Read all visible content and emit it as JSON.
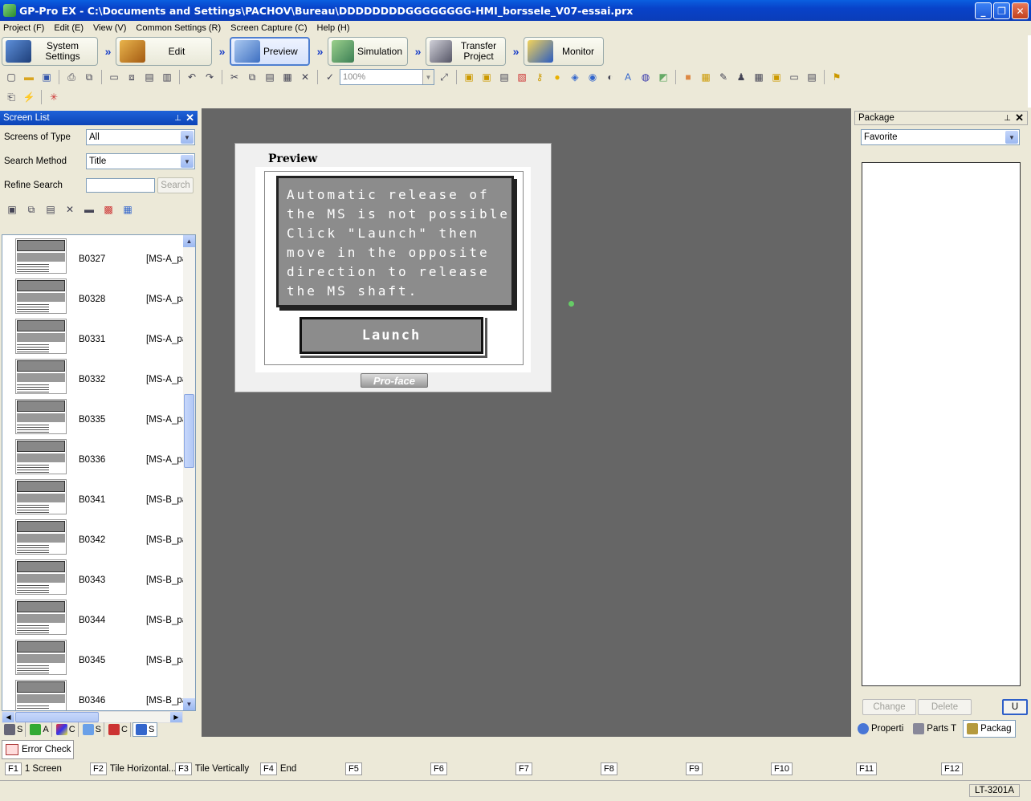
{
  "window": {
    "title": "GP-Pro EX - C:\\Documents and Settings\\PACHOV\\Bureau\\DDDDDDDDGGGGGGGG-HMI_borssele_V07-essai.prx",
    "minimize": "_",
    "maximize": "❐",
    "close": "✕"
  },
  "menu": [
    "Project (F)",
    "Edit (E)",
    "View (V)",
    "Common Settings (R)",
    "Screen Capture (C)",
    "Help (H)"
  ],
  "workflow": [
    {
      "label": "System Settings",
      "active": false
    },
    {
      "label": "Edit",
      "active": false
    },
    {
      "label": "Preview",
      "active": true
    },
    {
      "label": "Simulation",
      "active": false
    },
    {
      "label": "Transfer Project",
      "active": false
    },
    {
      "label": "Monitor",
      "active": false
    }
  ],
  "workflow_arrow": "»",
  "toolbar": {
    "zoom": "100%"
  },
  "screen_list": {
    "title": "Screen List",
    "screens_of_type_label": "Screens of Type",
    "screens_of_type_value": "All",
    "search_method_label": "Search Method",
    "search_method_value": "Title",
    "refine_search_label": "Refine Search",
    "refine_search_value": "",
    "search_button": "Search",
    "items": [
      {
        "id": "B0327",
        "name": "[MS-A_pa"
      },
      {
        "id": "B0328",
        "name": "[MS-A_pa"
      },
      {
        "id": "B0331",
        "name": "[MS-A_pa"
      },
      {
        "id": "B0332",
        "name": "[MS-A_pa"
      },
      {
        "id": "B0335",
        "name": "[MS-A_pa"
      },
      {
        "id": "B0336",
        "name": "[MS-A_pa"
      },
      {
        "id": "B0341",
        "name": "[MS-B_pa"
      },
      {
        "id": "B0342",
        "name": "[MS-B_pa"
      },
      {
        "id": "B0343",
        "name": "[MS-B_pa"
      },
      {
        "id": "B0344",
        "name": "[MS-B_pa"
      },
      {
        "id": "B0345",
        "name": "[MS-B_pa"
      },
      {
        "id": "B0346",
        "name": "[MS-B_pa"
      }
    ],
    "bottom_tabs": [
      "S",
      "A",
      "C",
      "S",
      "C",
      "S"
    ]
  },
  "preview": {
    "title": "Preview",
    "message": "Automatic release of\nthe MS is not possible\nClick \"Launch\" then\nmove in the opposite\ndirection to release\nthe MS shaft.",
    "button": "Launch",
    "logo": "Pro-face"
  },
  "package": {
    "title": "Package",
    "category": "Favorite",
    "change_button": "Change",
    "delete_button": "Delete",
    "extra_button": "U",
    "tabs": [
      "Properti",
      "Parts T",
      "Packag"
    ]
  },
  "error_check": "Error Check",
  "fkeys": [
    {
      "key": "F1",
      "label": "1 Screen"
    },
    {
      "key": "F2",
      "label": "Tile Horizontal..."
    },
    {
      "key": "F3",
      "label": "Tile Vertically"
    },
    {
      "key": "F4",
      "label": "End"
    },
    {
      "key": "F5",
      "label": ""
    },
    {
      "key": "F6",
      "label": ""
    },
    {
      "key": "F7",
      "label": ""
    },
    {
      "key": "F8",
      "label": ""
    },
    {
      "key": "F9",
      "label": ""
    },
    {
      "key": "F10",
      "label": ""
    },
    {
      "key": "F11",
      "label": ""
    },
    {
      "key": "F12",
      "label": ""
    }
  ],
  "status": {
    "model": "LT-3201A"
  }
}
